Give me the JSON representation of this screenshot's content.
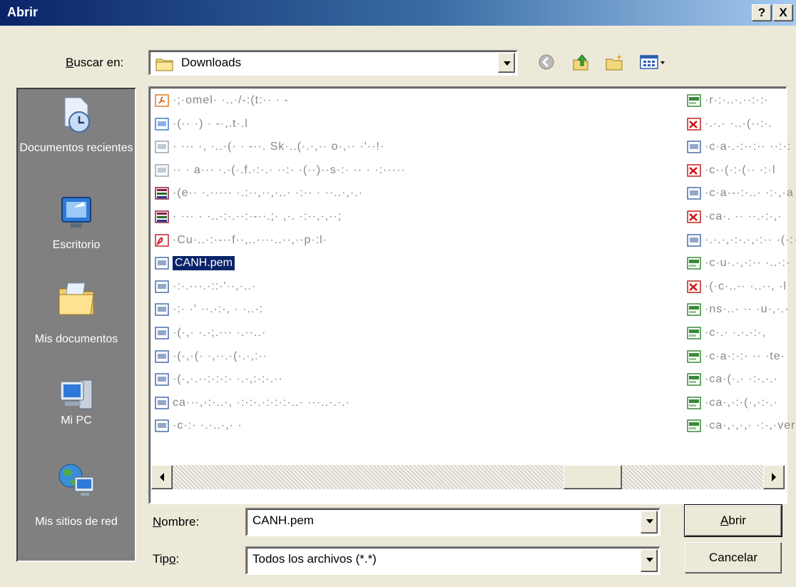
{
  "window": {
    "title": "Abrir",
    "help_label": "?",
    "close_label": "X"
  },
  "toolbar": {
    "lookin_label_prefix": "",
    "lookin_label_accel": "B",
    "lookin_label_rest": "uscar en:",
    "lookin_value": "Downloads",
    "icons": [
      "back-icon",
      "up-folder-icon",
      "new-folder-icon",
      "view-menu-icon"
    ]
  },
  "places": [
    {
      "label": "Documentos recientes",
      "icon": "recent-documents-icon"
    },
    {
      "label": "Escritorio",
      "icon": "desktop-icon"
    },
    {
      "label": "Mis documentos",
      "icon": "my-documents-icon"
    },
    {
      "label": "Mi PC",
      "icon": "my-computer-icon"
    },
    {
      "label": "Mis sitios de red",
      "icon": "network-places-icon"
    }
  ],
  "files": {
    "left_column": [
      {
        "name": "·;·omel·  ·..·/-:(t:··  ·  -",
        "icon": "java-file-icon"
      },
      {
        "name": "·(·· ·) ·  -·,.t·.l",
        "icon": "image-file-icon"
      },
      {
        "name": "·  ··· ·,  ·..·(· ·  -··. Sk·..(·.·,·· o·,·· ·'··!·",
        "icon": "text-file-icon"
      },
      {
        "name": "··  · a··· ·.·(·.f.·:·.·  ··:· ·(··)··s·:· ·· ·  ·:·····",
        "icon": "text-file-icon"
      },
      {
        "name": "·(e··  ·.·····  ·.:··,··,·..·  ·:·· ·  ··..·,·.·",
        "icon": "archive-file-icon"
      },
      {
        "name": "·  ··· ·  ·..·:·.··:·-··.;·  ,·.  ·:··,·,··;",
        "icon": "archive-file-icon"
      },
      {
        "name": "·Cu·..·:·-··f··,..····..··,··p·:l·",
        "icon": "pdf-file-icon"
      },
      {
        "name": "CANH.pem",
        "icon": "certificate-file-icon",
        "selected": true
      },
      {
        "name": "·:·.···.·::·'··,·..·",
        "icon": "certificate-file-icon"
      },
      {
        "name": "·:·  ·' ··.·:·,  ·  ·..·:",
        "icon": "certificate-file-icon"
      },
      {
        "name": "·(·,·  ·.·;.···  ·.··..·",
        "icon": "certificate-file-icon"
      },
      {
        "name": "·(·,·(·  ·,··.·(·.·,:··",
        "icon": "certificate-file-icon"
      },
      {
        "name": "·(·,·.··:·:·:·  ·.·,:·:·.··",
        "icon": "certificate-file-icon"
      },
      {
        "name": "ca···,·:·..·,  ·:·:·.·:·:·:·..·  ···..·.·.·",
        "icon": "certificate-file-icon"
      },
      {
        "name": "·c·:·  ·.·..·,·  ·",
        "icon": "certificate-file-icon"
      }
    ],
    "right_column": [
      {
        "name": "·r·:·..·.··:·:·",
        "icon": "cert-green-icon"
      },
      {
        "name": "·.·.·  ·..·(··:·.",
        "icon": "cert-revoked-icon"
      },
      {
        "name": "·c·a·.·:··:··  ··:·:",
        "icon": "cert-file-icon"
      },
      {
        "name": "·c··(·:·(··  ·:·l",
        "icon": "cert-revoked-icon"
      },
      {
        "name": "·c·a·-·:·..·  ·:·,·a",
        "icon": "cert-file-icon"
      },
      {
        "name": "·ca·.  ··  ··.·:·,·",
        "icon": "cert-revoked-icon"
      },
      {
        "name": "·.·.·,·:·.·,·:··  ·(·:·",
        "icon": "cert-file-icon"
      },
      {
        "name": "·c·u·.·,·:··  ·..·:·",
        "icon": "cert-green-icon"
      },
      {
        "name": "·(·c·..··  ·..··,  ·l",
        "icon": "cert-revoked-icon"
      },
      {
        "name": "·ns·..·  ··  ·u·,·.·",
        "icon": "cert-green-icon"
      },
      {
        "name": "·c·.·  ·.·.·:·,",
        "icon": "cert-green-icon"
      },
      {
        "name": "·c·a·:·:·  ··  ·te·",
        "icon": "cert-green-icon"
      },
      {
        "name": "·ca·(·.·  ·:·.·.·",
        "icon": "cert-green-icon"
      },
      {
        "name": "·ca·,·:·(·,·:·.·",
        "icon": "cert-green-icon"
      },
      {
        "name": "·ca·,·,·,·  ·:·,·ver",
        "icon": "cert-green-icon"
      }
    ]
  },
  "filename": {
    "label_accel": "N",
    "label_rest": "ombre:",
    "value": "CANH.pem"
  },
  "filetype": {
    "label_prefix": "Tip",
    "label_accel": "o",
    "label_rest": ":",
    "value": "Todos los archivos (*.*)"
  },
  "buttons": {
    "open_accel": "A",
    "open_rest": "brir",
    "cancel": "Cancelar"
  }
}
